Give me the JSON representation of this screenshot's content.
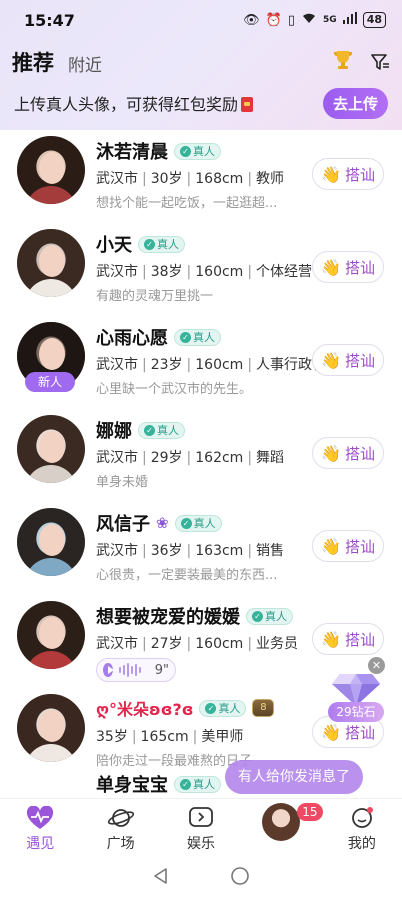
{
  "status_bar": {
    "time": "15:47",
    "battery": "48",
    "network": "5G"
  },
  "header": {
    "tab_active": "推荐",
    "tab_inactive": "附近"
  },
  "banner": {
    "text": "上传真人头像，可获得红包奖励",
    "button": "去上传"
  },
  "verified_label": "真人",
  "chat_label": "搭讪",
  "new_label": "新人",
  "users": [
    {
      "name": "沐若清晨",
      "verified": true,
      "city": "武汉市",
      "age": "30岁",
      "height": "168cm",
      "job": "教师",
      "bio": "想找个能一起吃饭，一起逛超..."
    },
    {
      "name": "小天",
      "verified": true,
      "city": "武汉市",
      "age": "38岁",
      "height": "160cm",
      "job": "个体经营",
      "bio": "有趣的灵魂万里挑一"
    },
    {
      "name": "心雨心愿",
      "verified": true,
      "city": "武汉市",
      "age": "23岁",
      "height": "160cm",
      "job": "人事行政管理",
      "bio": "心里缺一个武汉市的先生。",
      "is_new": true
    },
    {
      "name": "娜娜",
      "verified": true,
      "city": "武汉市",
      "age": "29岁",
      "height": "162cm",
      "job": "舞蹈",
      "bio": "单身未婚"
    },
    {
      "name": "风信子",
      "verified": true,
      "city": "武汉市",
      "age": "36岁",
      "height": "163cm",
      "job": "销售",
      "bio": "心很贵，一定要装最美的东西..."
    },
    {
      "name": "想要被宠爱的媛媛",
      "verified": true,
      "city": "武汉市",
      "age": "27岁",
      "height": "160cm",
      "job": "业务员",
      "bio": "",
      "voice_length": "9\""
    },
    {
      "name": "ღ°米朵ʚɞ?ɞ",
      "verified": true,
      "city": "",
      "age": "35岁",
      "height": "165cm",
      "job": "美甲师",
      "bio": "陪你走过一段最难熬的日子",
      "level": "8"
    },
    {
      "name": "单身宝宝",
      "verified": true,
      "city": "",
      "age": "",
      "height": "",
      "job": "",
      "bio": ""
    }
  ],
  "diamond_reward": {
    "label": "29钻石"
  },
  "toast": "有人给你发消息了",
  "bottom_nav": [
    {
      "label": "遇见",
      "active": true
    },
    {
      "label": "广场",
      "active": false
    },
    {
      "label": "娱乐",
      "active": false
    },
    {
      "label": "",
      "badge": "15"
    },
    {
      "label": "我的",
      "active": false
    }
  ],
  "colors": {
    "accent_purple": "#9b55d8",
    "upload_button": "#9b5cf0",
    "verified_green": "#36b39b",
    "badge_red": "#ee4a63"
  }
}
